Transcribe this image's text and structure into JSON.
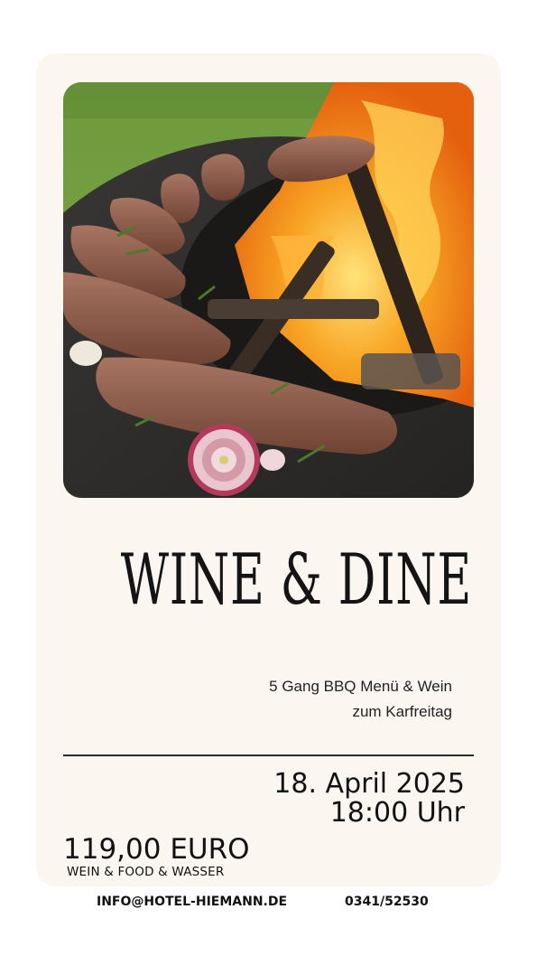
{
  "poster": {
    "title": "WINE & DINE",
    "subtitle_line1": "5 Gang BBQ Menü & Wein",
    "subtitle_line2": "zum Karfreitag",
    "date": "18. April 2025",
    "time": "18:00 Uhr",
    "price": "119,00 EURO",
    "price_includes": "WEIN & FOOD & WASSER",
    "email": "INFO@HOTEL-HIEMANN.DE",
    "phone": "0341/52530"
  },
  "colors": {
    "card_background": "#fcf6f1",
    "text": "#141414",
    "flame": "#f39a1e",
    "grass": "#6f9c3e",
    "grill_plate": "#2b2a28",
    "meat": "#8a5a45"
  }
}
